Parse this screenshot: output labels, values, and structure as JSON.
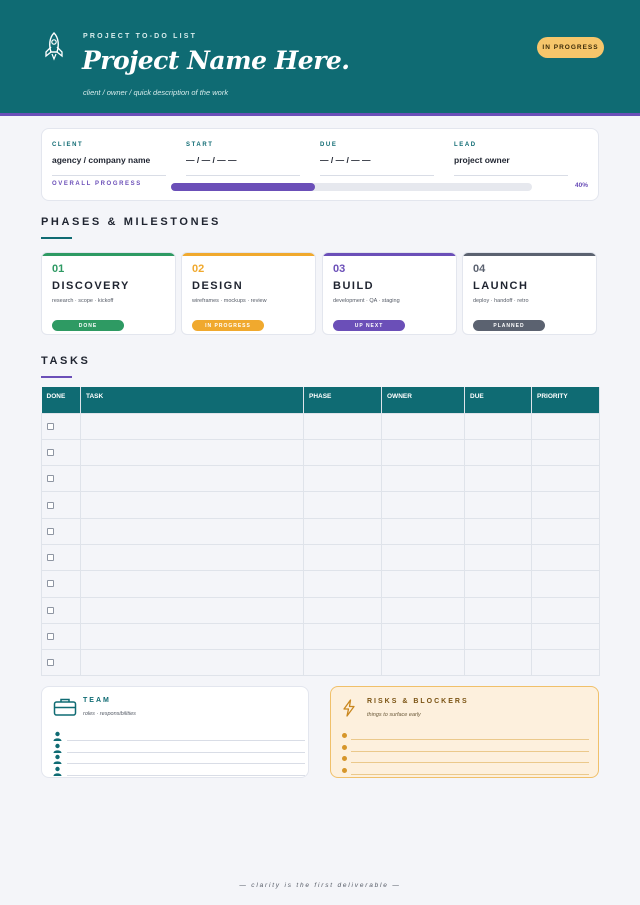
{
  "header": {
    "eyebrow": "PROJECT TO-DO LIST",
    "title": "Project Name Here.",
    "subtitle": "client / owner / quick description of the work",
    "status": "IN PROGRESS",
    "icon": "rocket-icon"
  },
  "info": {
    "fields": [
      {
        "label": "CLIENT",
        "value": "agency / company name"
      },
      {
        "label": "START",
        "value": "— / — / — —"
      },
      {
        "label": "DUE",
        "value": "— / — / — —"
      },
      {
        "label": "LEAD",
        "value": "project owner"
      }
    ],
    "progress_label": "OVERALL PROGRESS",
    "progress_fraction": 0.4,
    "progress_text": "40%"
  },
  "phases": {
    "title": "PHASES & MILESTONES",
    "items": [
      {
        "num": "01",
        "name": "DISCOVERY",
        "desc": "research · scope · kickoff",
        "status": "DONE",
        "color": "#2e9a63"
      },
      {
        "num": "02",
        "name": "DESIGN",
        "desc": "wireframes · mockups · review",
        "status": "IN PROGRESS",
        "color": "#f0a92e"
      },
      {
        "num": "03",
        "name": "BUILD",
        "desc": "development · QA · staging",
        "status": "UP NEXT",
        "color": "#6b4fb8"
      },
      {
        "num": "04",
        "name": "LAUNCH",
        "desc": "deploy · handoff · retro",
        "status": "PLANNED",
        "color": "#5b6270"
      }
    ]
  },
  "tasks": {
    "title": "TASKS",
    "columns": [
      "DONE",
      "TASK",
      "PHASE",
      "OWNER",
      "DUE",
      "PRIORITY"
    ],
    "row_count": 10
  },
  "team": {
    "title": "TEAM",
    "subtitle": "roles · responsibilities",
    "row_count": 4
  },
  "risks": {
    "title": "RISKS & BLOCKERS",
    "subtitle": "things to surface early",
    "row_count": 4
  },
  "footer": "— clarity is the first deliverable —",
  "colors": {
    "teal": "#0f6b73",
    "purple": "#6b4fb8",
    "amber": "#f6c66b"
  }
}
